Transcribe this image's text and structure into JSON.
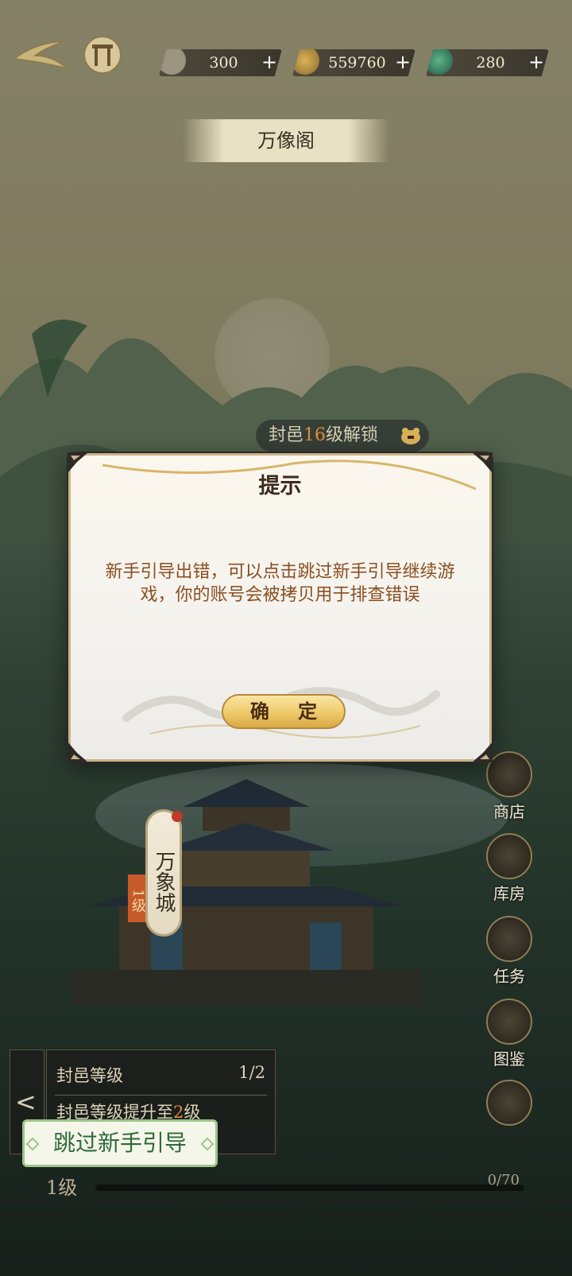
{
  "top_bar": {
    "resources": [
      {
        "name": "paper-icon",
        "value": "300"
      },
      {
        "name": "coin-icon",
        "value": "559760"
      },
      {
        "name": "jade-icon",
        "value": "280"
      }
    ],
    "plus": "+"
  },
  "banner": {
    "title": "万像阁"
  },
  "unlock": {
    "prefix": "封邑",
    "level": "16",
    "suffix": "级解锁"
  },
  "modal": {
    "title": "提示",
    "message": "新手引导出错，可以点击跳过新手引导继续游戏，你的账号会被拷贝用于排查错误",
    "confirm_label": "确 定"
  },
  "side_menu": [
    {
      "label": "商店",
      "icon": "shop-icon"
    },
    {
      "label": "库房",
      "icon": "warehouse-icon"
    },
    {
      "label": "任务",
      "icon": "task-icon"
    },
    {
      "label": "图鉴",
      "icon": "codex-icon"
    },
    {
      "label": "",
      "icon": "eye-icon"
    }
  ],
  "city": {
    "name": "万象城",
    "level": "1级"
  },
  "task": {
    "title": "封邑等级",
    "count": "1/2",
    "desc_prefix": "封邑等级提升至",
    "desc_level": "2",
    "desc_suffix": "级",
    "arrow": "<"
  },
  "skip_button": {
    "label": "跳过新手引导"
  },
  "bottom": {
    "level": "1级",
    "progress": "0/70"
  },
  "colors": {
    "accent": "#e48a3a",
    "modal_text": "#8a4f22",
    "skip_green": "#2f6a3a",
    "gold": "#eec96a"
  }
}
